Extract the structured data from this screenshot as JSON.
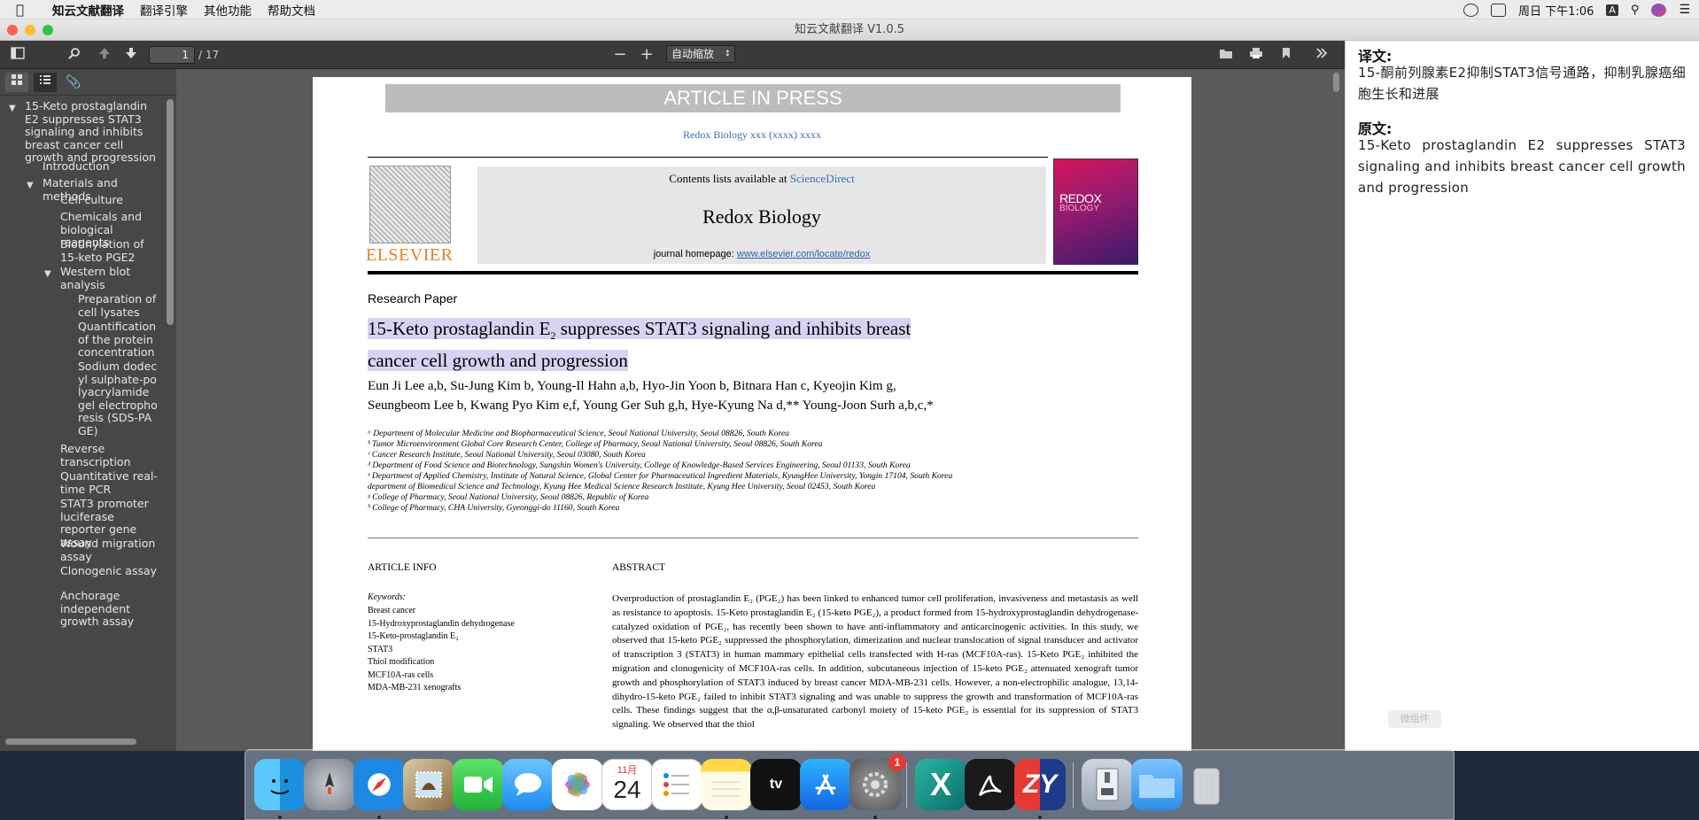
{
  "menubar": {
    "app_name": "知云文献翻译",
    "items": [
      "翻译引擎",
      "其他功能",
      "帮助文档"
    ],
    "clock": "周日 下午1:06",
    "input_method": "A"
  },
  "window": {
    "title": "知云文献翻译 V1.0.5"
  },
  "toolbar": {
    "page_current": "1",
    "page_total": "/ 17",
    "zoom_minus": "−",
    "zoom_plus": "+",
    "zoom_mode": "自动缩放"
  },
  "outline": [
    {
      "label": "15-Keto prostaglandin E2 suppresses STAT3 signaling and inhibits breast cancer cell growth and progression",
      "level": 0,
      "expanded": true
    },
    {
      "label": "Introduction",
      "level": 1
    },
    {
      "label": "Materials and methods",
      "level": 1,
      "expanded": true
    },
    {
      "label": "Cell culture",
      "level": 2
    },
    {
      "label": "Chemicals and biological reagents",
      "level": 2
    },
    {
      "label": "Biotinylation of 15-keto PGE2",
      "level": 2
    },
    {
      "label": "Western blot analysis",
      "level": 2,
      "expanded": true
    },
    {
      "label": "Preparation of cell lysates",
      "level": 3
    },
    {
      "label": "Quantification of the protein concentration",
      "level": 3
    },
    {
      "label": "Sodium dodecyl sulphate-polyacrylamide gel electrophoresis (SDS-PAGE)",
      "level": 3
    },
    {
      "label": "Reverse transcription",
      "level": 2
    },
    {
      "label": "Quantitative real-time PCR",
      "level": 2
    },
    {
      "label": "STAT3 promoter luciferase reporter gene assay",
      "level": 2
    },
    {
      "label": "Wound migration assay",
      "level": 2
    },
    {
      "label": "Clonogenic assay",
      "level": 2
    },
    {
      "label": "Anchorage independent growth assay",
      "level": 2
    }
  ],
  "document": {
    "banner": "ARTICLE IN PRESS",
    "journal_ref": "Redox Biology xxx (xxxx) xxxx",
    "publisher": "ELSEVIER",
    "contents_prefix": "Contents lists available at ",
    "contents_link": "ScienceDirect",
    "journal_name": "Redox Biology",
    "homepage_prefix": "journal homepage: ",
    "homepage_url": "www.elsevier.com/locate/redox",
    "cover_title": "REDOX",
    "cover_subtitle": "BIOLOGY",
    "paper_type": "Research Paper",
    "title_line1_a": "15-Keto prostaglandin E",
    "title_sub": "2",
    "title_line1_b": " suppresses STAT3 signaling and inhibits breast ",
    "title_line2": "cancer cell growth and progression",
    "authors_line1": "Eun Ji Lee a,b, Su-Jung Kim b, Young-Il Hahn a,b, Hyo-Jin Yoon b, Bitnara Han c, Kyeojin Kim g,",
    "authors_line2": "Seungbeom Lee b, Kwang Pyo Kim e,f, Young Ger Suh g,h, Hye-Kyung Na d,** Young-Joon Surh a,b,c,*",
    "affiliations": [
      "ᵃ Department of Molecular Medicine and Biopharmaceutical Science, Seoul National University, Seoul 08826, South Korea",
      "ᵇ Tumor Microenvironment Global Core Research Center, College of Pharmacy, Seoul National University, Seoul 08826, South Korea",
      "ᶜ Cancer Research Institute, Seoul National University, Seoul 03080, South Korea",
      "ᵈ Department of Food Science and Biotechnology, Sungshin Women's University, College of Knowledge-Based Services Engineering, Seoul 01133, South Korea",
      "ᵉ Department of Applied Chemistry, Institute of Natural Science, Global Center for Pharmaceutical Ingredient Materials, KyungHee University, Yongin 17104, South Korea",
      "department of Biomedical Science and Technology, Kyung Hee Medical Science Research Institute, Kyung Hee University, Seoul 02453, South Korea",
      "ᵍ College of Pharmacy, Seoul National University, Seoul 08826, Republic of Korea",
      "ʰ College of Pharmacy, CHA University, Gyeonggi-do 11160, South Korea"
    ],
    "article_info_heading": "ARTICLE INFO",
    "keywords_heading": "Keywords:",
    "keywords": [
      "Breast cancer",
      "15-Hydroxyprostaglandin dehydrogenase",
      "15-Keto-prostaglandin E₂",
      "STAT3",
      "Thiol modification",
      "MCF10A-ras cells",
      "MDA-MB-231 xenografts"
    ],
    "abstract_heading": "ABSTRACT",
    "abstract": "Overproduction of prostaglandin E₂ (PGE₂) has been linked to enhanced tumor cell proliferation, invasiveness and metastasis as well as resistance to apoptosis. 15-Keto prostaglandin E₂ (15-keto PGE₂), a product formed from 15-hydroxyprostaglandin dehydrogenase-catalyzed oxidation of PGE₂, has recently been shown to have anti-inflammatory and anticarcinogenic activities. In this study, we observed that 15-keto PGE₂ suppressed the phosphorylation, dimerization and nuclear translocation of signal transducer and activator of transcription 3 (STAT3) in human mammary epithelial cells transfected with H-ras (MCF10A-ras). 15-Keto PGE₂ inhibited the migration and clonogenicity of MCF10A-ras cells. In addition, subcutaneous injection of 15-keto PGE₂ attenuated xenograft tumor growth and phosphorylation of STAT3 induced by breast cancer MDA-MB-231 cells. However, a non-electrophilic analogue, 13,14-dihydro-15-keto PGE₂ failed to inhibit STAT3 signaling and was unable to suppress the growth and transformation of MCF10A-ras cells. These findings suggest that the α,β-unsaturated carbonyl moiety of 15-keto PGE₂ is essential for its suppression of STAT3 signaling. We observed that the thiol"
  },
  "translation_panel": {
    "translation_heading": "译文:",
    "translation_text": "15-酮前列腺素E2抑制STAT3信号通路，抑制乳腺癌细胞生长和进展",
    "source_heading": "原文:",
    "source_text": "15-Keto prostaglandin E2 suppresses STAT3 signaling and inhibits breast cancer cell growth and progression",
    "watermark": "微组件"
  },
  "dock": {
    "calendar_month": "11月",
    "calendar_day": "24",
    "tv_label": "tv",
    "settings_badge": "1",
    "x_label": "X",
    "zy_label": "ZY"
  },
  "colors": {
    "highlight": "#d7d3f2",
    "link": "#3a6fb0",
    "elsevier_orange": "#e2812a"
  }
}
